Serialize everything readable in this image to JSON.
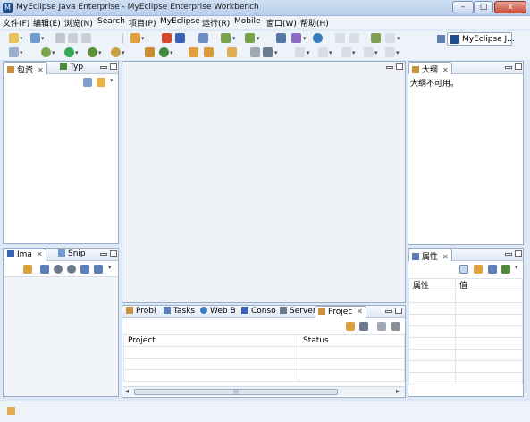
{
  "window": {
    "title": "MyEclipse Java Enterprise  -  MyEclipse Enterprise Workbench",
    "minimize": "–",
    "maximize": "□",
    "close": "x"
  },
  "menu": [
    "文件(F)",
    "编辑(E)",
    "浏览(N)",
    "Search",
    "项目(P)",
    "MyEclipse",
    "运行(R)",
    "Mobile",
    "窗口(W)",
    "帮助(H)"
  ],
  "perspective": {
    "label": "MyEclipse J..."
  },
  "views": {
    "package": {
      "tab1": "包资",
      "tab2": "Typ"
    },
    "image": {
      "tab1": "Ima",
      "tab2": "Snip"
    },
    "outline": {
      "tab": "大纲",
      "message": "大纲不可用。"
    },
    "properties": {
      "tab": "属性",
      "col1": "属性",
      "col2": "值"
    },
    "bottom": {
      "tabs": [
        "Probl",
        "Tasks",
        "Web B",
        "Conso",
        "Server",
        "Projec"
      ],
      "col1": "Project",
      "col2": "Status",
      "scroll_grip": "|||"
    }
  },
  "colors": {
    "accent": "#1f4e8c",
    "chrome_bg": "#dfe9f5",
    "toolbar_bg": "#eef3fa"
  },
  "icons": {
    "close": "✕",
    "arrow_down": "▾",
    "arrow_left": "◂",
    "arrow_right": "▸"
  }
}
